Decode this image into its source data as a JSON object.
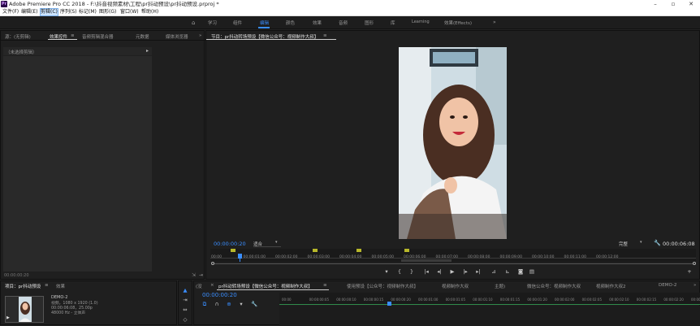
{
  "app_title": "Adobe Premiere Pro CC 2018 - F:\\抖音视频素材\\工程\\pr抖动预设\\pr抖动预设.prproj *",
  "menu": [
    "文件(F)",
    "编辑(E)",
    "剪辑(C)",
    "序列(S)",
    "标记(M)",
    "图形(G)",
    "窗口(W)",
    "帮助(H)"
  ],
  "workspaces": [
    "学习",
    "组件",
    "编辑",
    "颜色",
    "效果",
    "音频",
    "图形",
    "库",
    "Learning",
    "效果(Effects)"
  ],
  "source_tabs": [
    "源：(无剪辑)",
    "效果控件",
    "音频剪辑混合器",
    "元数据",
    "媒体浏览器"
  ],
  "effect_controls_header": "（未选择剪辑）",
  "effect_timecode": "00:00:00:20",
  "program_tab": "节目：pr抖动转场预设【微信公众号：视频制作大叔】",
  "program": {
    "timecode": "00:00:00:20",
    "fit": "适合",
    "quality": "完整",
    "duration": "00:00:06:08",
    "ruler": [
      "00:00",
      "00:00:01:00",
      "00:00:02:00",
      "00:00:03:00",
      "00:00:04:00",
      "00:00:05:00",
      "00:00:06:00",
      "00:00:07:00",
      "00:00:08:00",
      "00:00:09:00",
      "00:00:10:00",
      "00:00:11:00",
      "00:00:12:00"
    ]
  },
  "project": {
    "tabs": [
      "项目：pr抖动预设",
      "效果"
    ],
    "clip_name": "DEMO-2",
    "clip_info": [
      "视频，1080 x 1920 (1.0)",
      "00:00:06:08，25.00p",
      "48000 Hz - 立体声"
    ]
  },
  "timeline": {
    "tabs": [
      "(没",
      "pr抖动转场预设【微信公众号：视频制作大叔】",
      "使用预设【公众号：视频制作大叔】",
      "视频制作大叔",
      "主题)",
      "微信公众号：视频制作大叔",
      "视频制作大叔2",
      "DEMO-2"
    ],
    "timecode": "00:00:00:20",
    "ruler": [
      "00:00",
      "00:00:00:05",
      "00:00:00:10",
      "00:00:00:15",
      "00:00:00:20",
      "00:00:01:00",
      "00:00:01:05",
      "00:00:01:10",
      "00:00:01:15",
      "00:00:01:20",
      "00:00:02:00",
      "00:00:02:05",
      "00:00:02:10",
      "00:00:02:15",
      "00:00:02:20",
      "00:00:03:00"
    ]
  },
  "colors": {
    "accent": "#3a8eff",
    "marker": "#b8b82a",
    "bg": "#232323"
  }
}
